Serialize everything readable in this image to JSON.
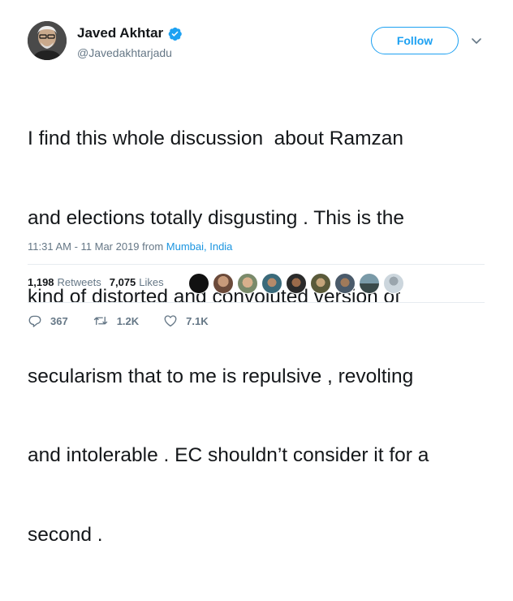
{
  "user": {
    "name": "Javed Akhtar",
    "handle": "@Javedakhtarjadu",
    "follow_label": "Follow"
  },
  "tweet": {
    "lines": [
      "I find this whole discussion  about Ramzan",
      "and elections totally disgusting . This is the",
      "kind of distorted and convoluted version of",
      "secularism that to me is repulsive , revolting",
      "and intolerable . EC shouldn’t consider it for a",
      "second ."
    ]
  },
  "meta": {
    "time_date": "11:31 AM - 11 Mar 2019 from ",
    "location": "Mumbai, India"
  },
  "stats": {
    "retweets_count": "1,198",
    "retweets_label": "Retweets",
    "likes_count": "7,075",
    "likes_label": "Likes"
  },
  "actions": {
    "replies": "367",
    "retweets": "1.2K",
    "likes": "7.1K"
  },
  "colors": {
    "accent": "#1da1f2",
    "link": "#1b95e0",
    "muted": "#657786"
  }
}
